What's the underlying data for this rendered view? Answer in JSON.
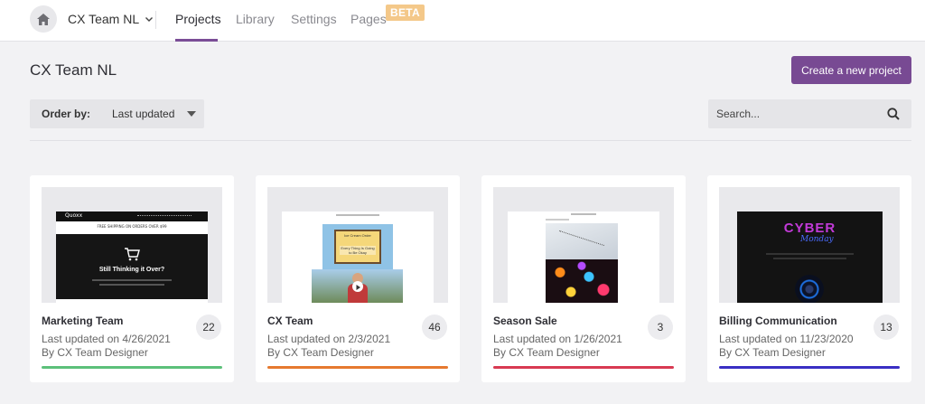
{
  "nav": {
    "team": "CX Team NL",
    "tabs": [
      {
        "label": "Projects"
      },
      {
        "label": "Library"
      },
      {
        "label": "Settings"
      },
      {
        "label": "Pages"
      }
    ],
    "beta_badge": "BETA"
  },
  "header": {
    "title": "CX Team NL",
    "create_button": "Create a new project"
  },
  "filters": {
    "order_label": "Order by:",
    "order_value": "Last updated",
    "search_placeholder": "Search..."
  },
  "projects": [
    {
      "name": "Marketing Team",
      "updated": "Last updated on 4/26/2021",
      "by": "By CX Team Designer",
      "count": "22",
      "color": "#5cc07a",
      "thumb": {
        "headline": "Still Thinking it Over?",
        "banner": "FREE SHIPPING ON ORDERS OVER $99",
        "brand": "Quoxx"
      }
    },
    {
      "name": "CX Team",
      "updated": "Last updated on 2/3/2021",
      "by": "By CX Team Designer",
      "count": "46",
      "color": "#e6792f",
      "thumb": {
        "sign_top": "Ice Cream Order",
        "sign_bottom": "Every Thing Is Going to Be Okay"
      }
    },
    {
      "name": "Season Sale",
      "updated": "Last updated on 1/26/2021",
      "by": "By CX Team Designer",
      "count": "3",
      "color": "#d83a52",
      "thumb": {}
    },
    {
      "name": "Billing Communication",
      "updated": "Last updated on 11/23/2020",
      "by": "By CX Team Designer",
      "count": "13",
      "color": "#3a2fc4",
      "thumb": {
        "line1": "CYBER",
        "line2": "Monday"
      }
    }
  ]
}
